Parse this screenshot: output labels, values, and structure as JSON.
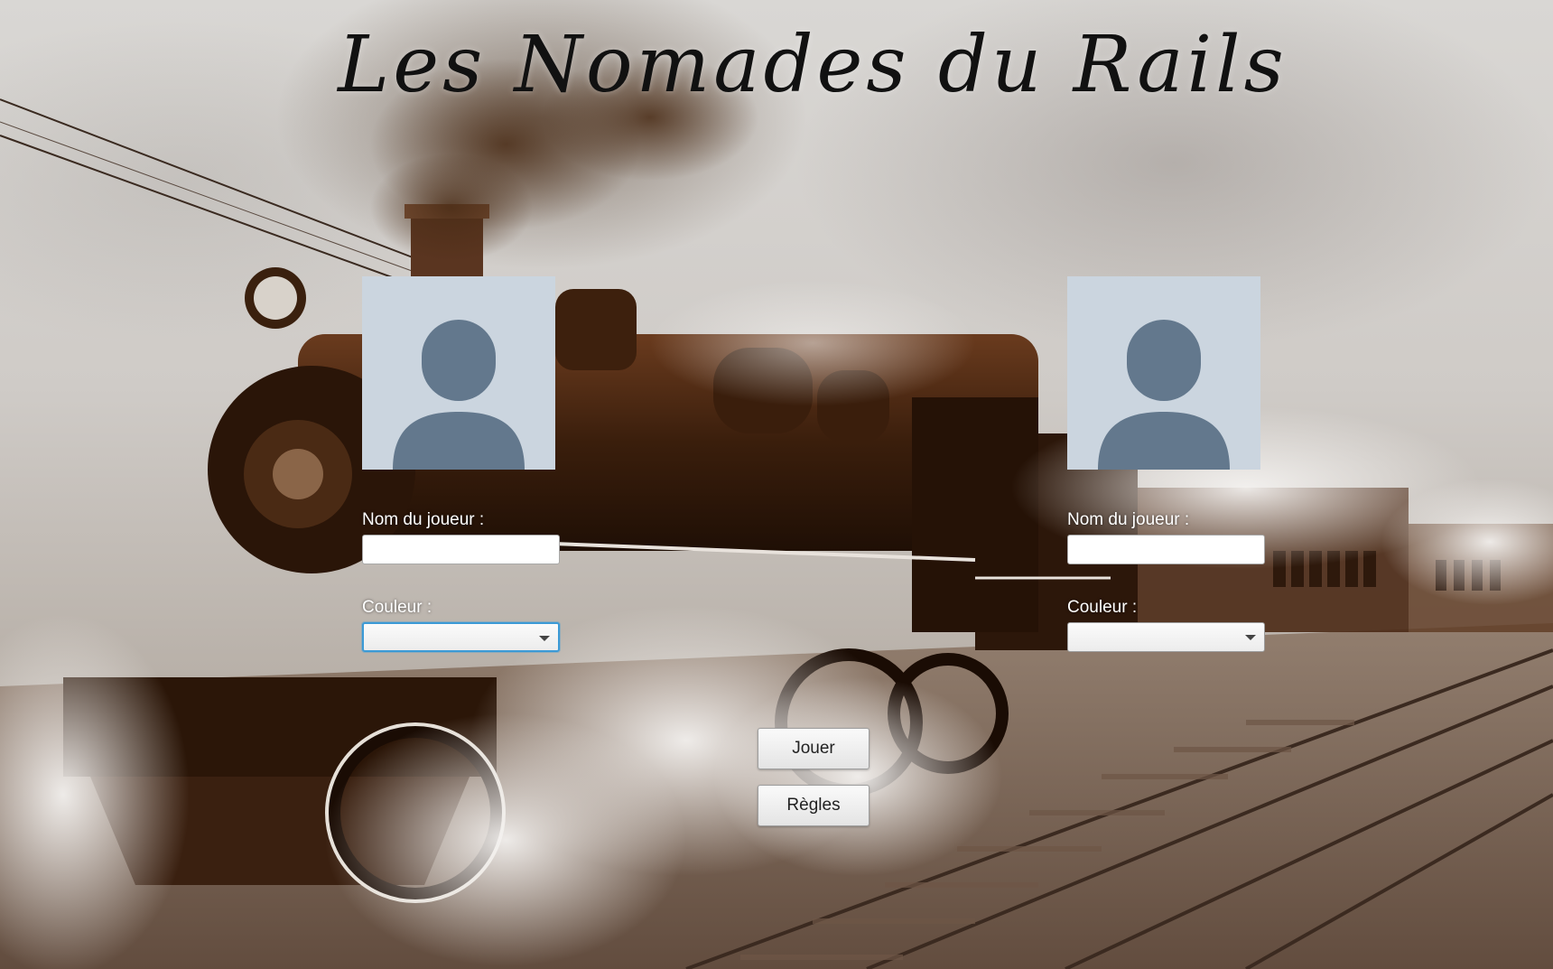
{
  "window": {
    "title": "Les Nomades du Rails"
  },
  "players": [
    {
      "avatar_icon": "user-silhouette-icon",
      "name_label": "Nom du joueur :",
      "name_value": "",
      "color_label": "Couleur :",
      "color_value": ""
    },
    {
      "avatar_icon": "user-silhouette-icon",
      "name_label": "Nom du joueur :",
      "name_value": "",
      "color_label": "Couleur :",
      "color_value": ""
    }
  ],
  "actions": {
    "play_label": "Jouer",
    "rules_label": "Règles"
  },
  "colors": {
    "avatar_background": "#cbd5df",
    "avatar_silhouette": "#63788d",
    "focus_ring": "#3c9ad6",
    "sepia_dark": "#3f220f",
    "sepia_mid": "#7a4a2a"
  }
}
